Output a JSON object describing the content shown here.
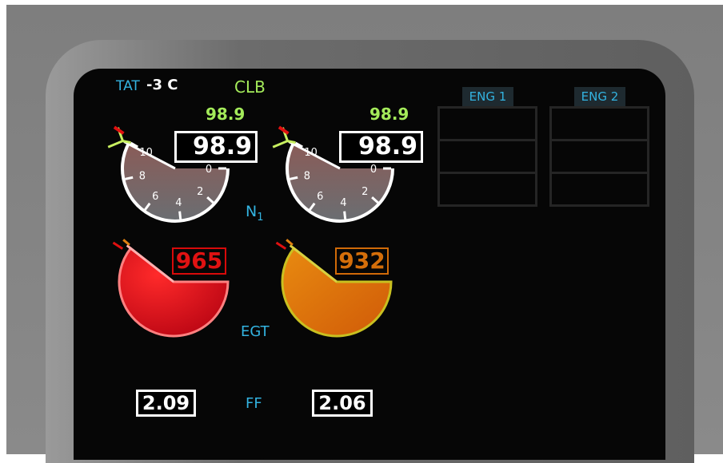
{
  "status": {
    "tat_label": "TAT",
    "tat_value": "-3 C",
    "thrust_mode": "CLB"
  },
  "engines": [
    {
      "n1_target": "98.9",
      "n1_actual": "98.9",
      "n1_needle_fraction": 0.989,
      "n1_scale_labels": [
        "10",
        "8",
        "6",
        "4",
        "2",
        "0"
      ],
      "egt_value": "965",
      "egt_color": "#e01212",
      "fuel_flow": "2.09"
    },
    {
      "n1_target": "98.9",
      "n1_actual": "98.9",
      "n1_needle_fraction": 0.989,
      "n1_scale_labels": [
        "10",
        "8",
        "6",
        "4",
        "2",
        "0"
      ],
      "egt_value": "932",
      "egt_color": "#d46e0a",
      "fuel_flow": "2.06"
    }
  ],
  "labels": {
    "n1": "N",
    "n1_sub": "1",
    "egt": "EGT",
    "ff": "FF"
  },
  "eng_panels": [
    {
      "label": "ENG 1"
    },
    {
      "label": "ENG 2"
    }
  ],
  "colors": {
    "cyan": "#33b3e0",
    "green": "#a4eb5a",
    "white": "#ffffff",
    "egt_red": "#e01212",
    "egt_amber": "#d46e0a"
  }
}
